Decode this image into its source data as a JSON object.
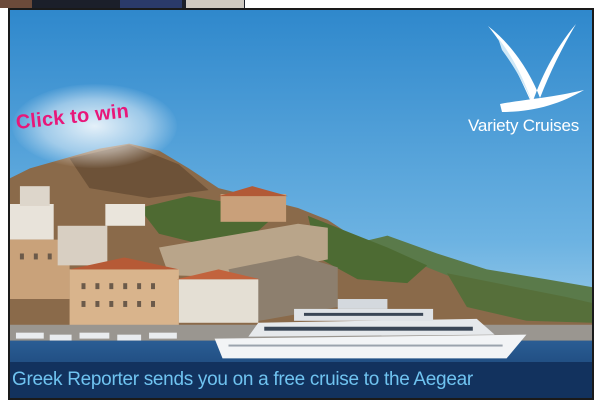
{
  "ad": {
    "cta": "Click to win",
    "brand": "Variety Cruises",
    "caption": "Greek Reporter sends you on a free cruise to the Aegear"
  },
  "colors": {
    "sky_top": "#3d95d4",
    "sky_bottom": "#b7dcf0",
    "sea": "#1d4f8a",
    "cta": "#e8177a",
    "caption_bg": "#12325e",
    "caption_text": "#6fc3f0"
  },
  "icons": {
    "brand_mark": "wave-v-logo-icon"
  }
}
